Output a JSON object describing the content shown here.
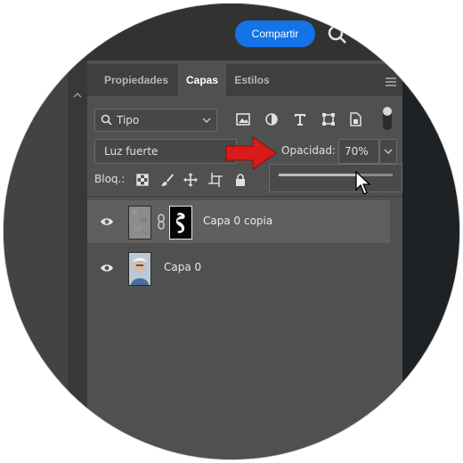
{
  "topbar": {
    "share_label": "Compartir"
  },
  "panel": {
    "tabs": [
      {
        "label": "Propiedades",
        "active": false
      },
      {
        "label": "Capas",
        "active": true
      },
      {
        "label": "Estilos",
        "active": false
      }
    ],
    "filter": {
      "kind_label": "Tipo"
    },
    "blend": {
      "mode": "Luz fuerte"
    },
    "opacity": {
      "label": "Opacidad:",
      "value": "70%",
      "slider_level": 0.7
    },
    "lock": {
      "label": "Bloq.:"
    },
    "layers": [
      {
        "name": "Capa 0 copia",
        "selected": true,
        "has_mask": true
      },
      {
        "name": "Capa 0",
        "selected": false,
        "has_mask": false
      }
    ]
  },
  "colors": {
    "accent": "#1473e6",
    "panel_bg": "#505050",
    "selected_row": "#5f5f5f",
    "arrow": "#d91a1a"
  }
}
